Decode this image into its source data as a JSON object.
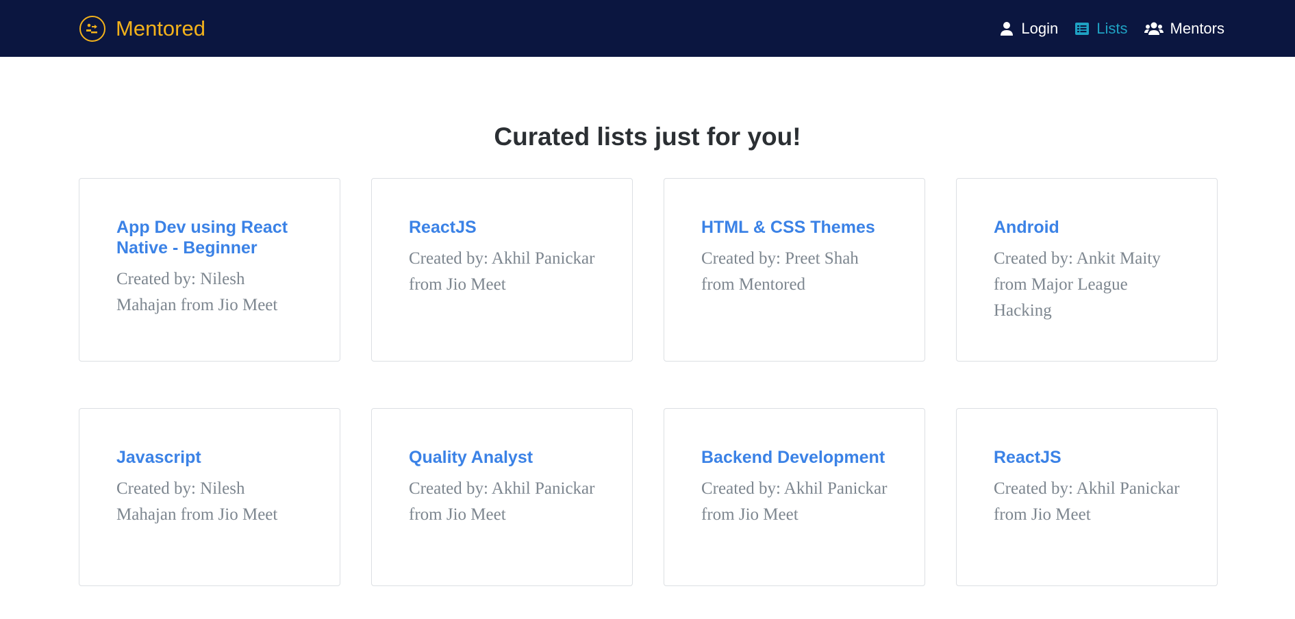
{
  "app": {
    "brand": "Mentored"
  },
  "nav": {
    "items": [
      {
        "label": "Login",
        "icon": "user-icon",
        "active": false
      },
      {
        "label": "Lists",
        "icon": "list-icon",
        "active": true
      },
      {
        "label": "Mentors",
        "icon": "users-icon",
        "active": false
      }
    ]
  },
  "main": {
    "title": "Curated lists just for you!",
    "cards": [
      {
        "title": "App Dev using React Native - Beginner",
        "author": "Created by: Nilesh Mahajan from Jio Meet"
      },
      {
        "title": "ReactJS",
        "author": "Created by: Akhil Panickar from Jio Meet"
      },
      {
        "title": "HTML & CSS Themes",
        "author": "Created by: Preet Shah from Mentored"
      },
      {
        "title": "Android",
        "author": "Created by: Ankit Maity from Major League Hacking"
      },
      {
        "title": "Javascript",
        "author": "Created by: Nilesh Mahajan from Jio Meet"
      },
      {
        "title": "Quality Analyst",
        "author": "Created by: Akhil Panickar from Jio Meet"
      },
      {
        "title": "Backend Development",
        "author": "Created by: Akhil Panickar from Jio Meet"
      },
      {
        "title": "ReactJS",
        "author": "Created by: Akhil Panickar from Jio Meet"
      }
    ]
  },
  "colors": {
    "navbar_bg": "#0b1640",
    "brand": "#f3b21b",
    "nav_active": "#1fa2c3",
    "card_title": "#3b82e6",
    "card_author": "#7d868f"
  }
}
